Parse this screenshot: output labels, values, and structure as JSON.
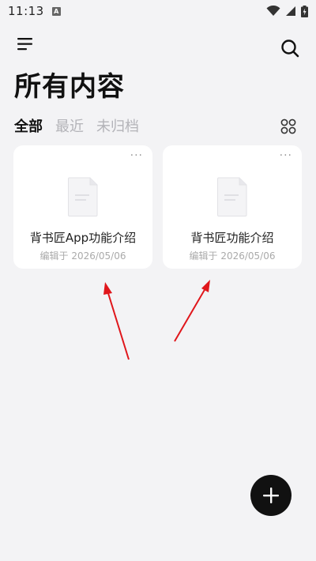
{
  "status_bar": {
    "time": "11:13",
    "notification_icon": "a-icon",
    "icons": [
      "wifi-icon",
      "signal-icon",
      "battery-charging-icon"
    ]
  },
  "header": {
    "menu_icon": "menu-icon",
    "search_icon": "search-icon",
    "title": "所有内容"
  },
  "tabs": [
    {
      "label": "全部",
      "active": true
    },
    {
      "label": "最近",
      "active": false
    },
    {
      "label": "未归档",
      "active": false
    }
  ],
  "view_toggle_icon": "grid-view-icon",
  "documents": [
    {
      "title": "背书匠App功能介绍",
      "date": "编辑于 2026/05/06",
      "more": "···"
    },
    {
      "title": "背书匠功能介绍",
      "date": "编辑于 2026/05/06",
      "more": "···"
    }
  ],
  "fab": {
    "icon": "plus-icon"
  },
  "colors": {
    "background": "#f3f3f5",
    "card": "#ffffff",
    "fab": "#111111",
    "annotation_arrow": "#e0161b",
    "inactive_tab": "#b3b3b8"
  }
}
